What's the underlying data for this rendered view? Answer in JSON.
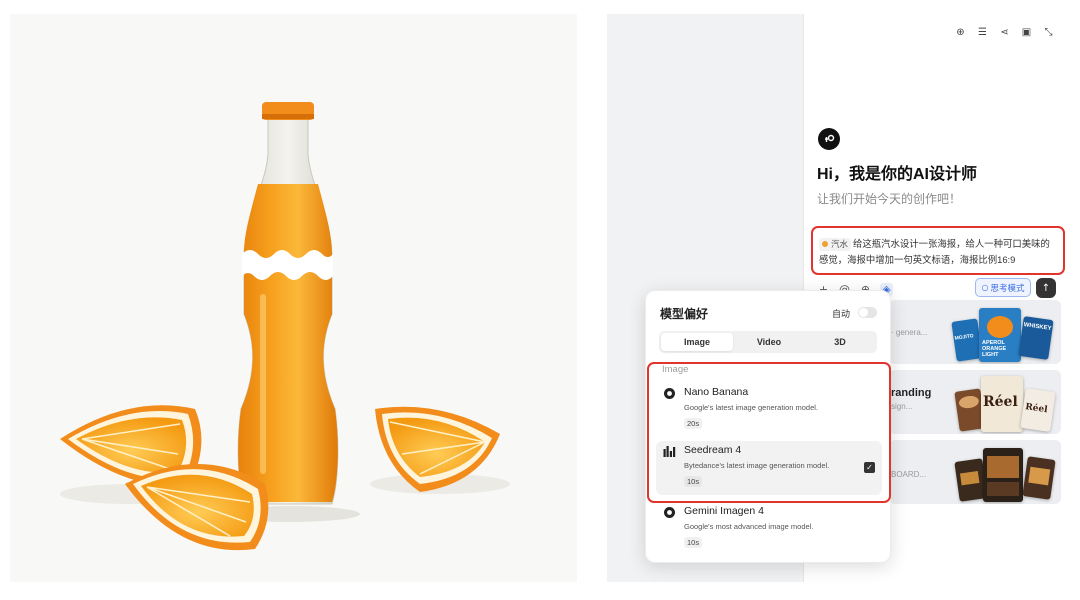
{
  "chat": {
    "greeting": "Hi，我是你的AI设计师",
    "subtitle": "让我们开始今天的创作吧！",
    "prompt": {
      "tag": "汽水",
      "text": "给这瓶汽水设计一张海报，给人一种可口美味的感觉，海报中增加一句英文标语，海报比例16:9"
    },
    "think_mode": "思考模式",
    "top_icons": [
      "plus-circle-icon",
      "filter-icon",
      "share-icon",
      "gallery-icon",
      "collapse-icon"
    ]
  },
  "cards": [
    {
      "text": "· genera..."
    },
    {
      "title": "randing",
      "sub": "sign..."
    },
    {
      "text": "BOARD..."
    }
  ],
  "card_thumbs": {
    "aperol": "APEROL ORANGE LIGHT",
    "whiskey": "WHISKEY",
    "mojito": "MOJITO",
    "reel": "Réel",
    "reel_small": "Réel"
  },
  "popup": {
    "title": "模型偏好",
    "auto_label": "自动",
    "tabs": [
      "Image",
      "Video",
      "3D"
    ],
    "section_label": "Image",
    "models": [
      {
        "name": "Nano Banana",
        "desc": "Google's latest image generation model.",
        "time": "20s",
        "selected": false
      },
      {
        "name": "Seedream 4",
        "desc": "Bytedance's latest image generation model.",
        "time": "10s",
        "selected": true
      },
      {
        "name": "Gemini Imagen 4",
        "desc": "Google's most advanced image model.",
        "time": "10s",
        "selected": false
      }
    ]
  },
  "colors": {
    "highlight_red": "#e0342c",
    "accent_blue": "#3a6de0",
    "orange": "#f28c1a"
  }
}
